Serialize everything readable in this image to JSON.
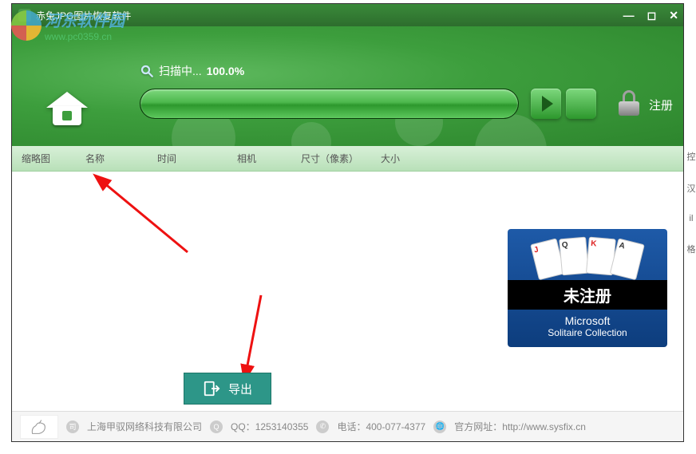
{
  "titlebar": {
    "title": "赤兔JPG图片恢复软件"
  },
  "watermark": {
    "cn": "河东软件园",
    "url": "www.pc0359.cn"
  },
  "scan": {
    "label": "扫描中...",
    "percent": "100.0%"
  },
  "register": {
    "label": "注册"
  },
  "columns": {
    "thumbnail": "缩略图",
    "name": "名称",
    "time": "时间",
    "camera": "相机",
    "dimensions": "尺寸（像素）",
    "filesize": "大小"
  },
  "promo": {
    "unregistered": "未注册",
    "title": "Microsoft",
    "subtitle": "Solitaire Collection",
    "cards": [
      "J",
      "Q",
      "K",
      "A"
    ]
  },
  "export": {
    "label": "导出"
  },
  "footer": {
    "company": "上海甲驭网络科技有限公司",
    "qq_label": "QQ：",
    "qq": "1253140355",
    "phone_label": "电话：",
    "phone": "400-077-4377",
    "site_label": "官方网址：",
    "site": "http://www.sysfix.cn"
  },
  "bg_chars": [
    "控",
    "汉",
    "il",
    "格"
  ]
}
